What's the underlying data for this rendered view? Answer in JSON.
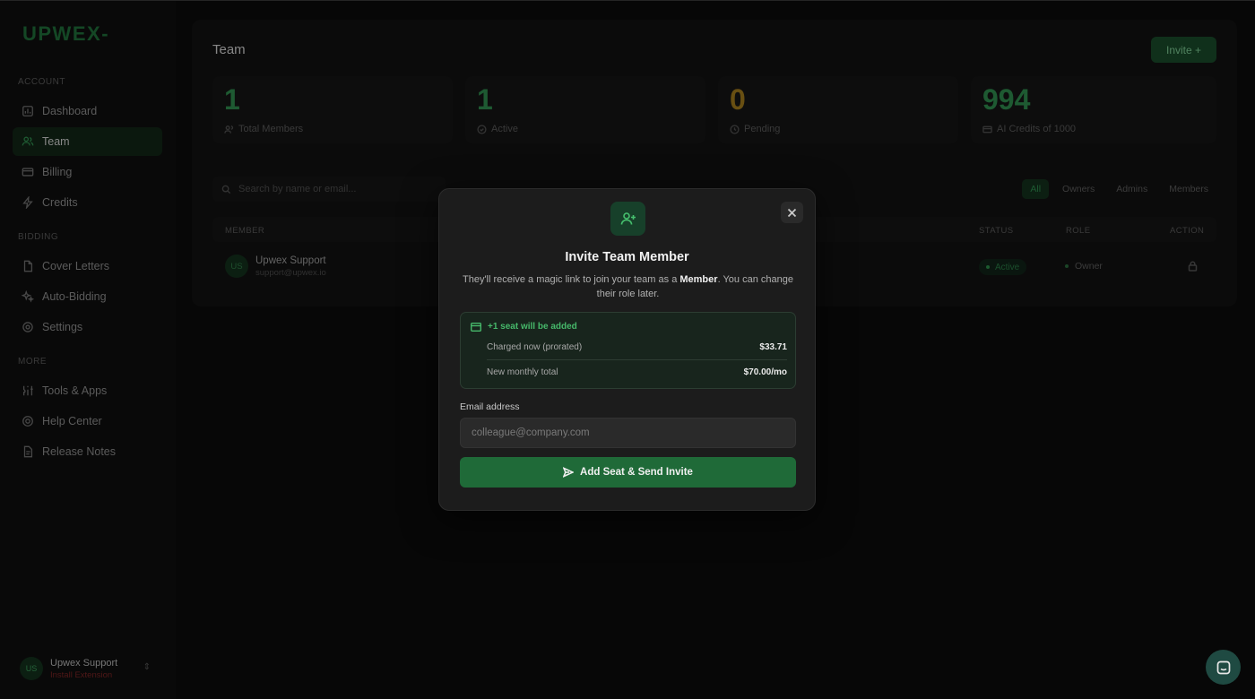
{
  "brand": {
    "logo": "UPWEX",
    "logo_suffix": "-"
  },
  "sidebar": {
    "sections": {
      "account": "ACCOUNT",
      "bidding": "BIDDING",
      "more": "MORE"
    },
    "items": [
      {
        "label": "Dashboard",
        "icon": "dashboard-icon"
      },
      {
        "label": "Team",
        "icon": "team-icon",
        "active": true
      },
      {
        "label": "Billing",
        "icon": "billing-icon"
      },
      {
        "label": "Credits",
        "icon": "bolt-icon"
      },
      {
        "label": "Cover Letters",
        "icon": "document-icon"
      },
      {
        "label": "Auto-Bidding",
        "icon": "sparkle-icon"
      },
      {
        "label": "Settings",
        "icon": "gear-icon"
      },
      {
        "label": "Tools & Apps",
        "icon": "tools-icon"
      },
      {
        "label": "Help Center",
        "icon": "help-icon"
      },
      {
        "label": "Release Notes",
        "icon": "notes-icon"
      }
    ],
    "user": {
      "initials": "US",
      "name": "Upwex Support",
      "sub": "Install Extension"
    }
  },
  "main": {
    "title": "Team",
    "invite_button": "Invite +",
    "stats": [
      {
        "value": "1",
        "label": "Total Members",
        "color": "#2f8b4d"
      },
      {
        "value": "1",
        "label": "Active",
        "color": "#2f8b4d"
      },
      {
        "value": "0",
        "label": "Pending",
        "color": "#a07a1c"
      },
      {
        "value": "994",
        "label": "AI Credits of 1000",
        "color": "#2f8b4d"
      }
    ],
    "search_placeholder": "Search by name or email...",
    "filters": [
      "All",
      "Owners",
      "Admins",
      "Members"
    ],
    "table": {
      "headers": {
        "member": "MEMBER",
        "status": "STATUS",
        "role": "ROLE",
        "action": "ACTION"
      },
      "rows": [
        {
          "initials": "US",
          "name": "Upwex Support",
          "email": "support@upwex.io",
          "status": "Active",
          "role": "Owner"
        }
      ]
    }
  },
  "modal": {
    "title": "Invite Team Member",
    "desc_before": "They'll receive a magic link to join your team as a ",
    "desc_role": "Member",
    "desc_after": ". You can change their role later.",
    "seat_notice": "+1 seat will be added",
    "charged_label": "Charged now (prorated)",
    "charged_value": "$33.71",
    "monthly_label": "New monthly total",
    "monthly_value": "$70.00/mo",
    "email_label": "Email address",
    "email_placeholder": "colleague@company.com",
    "email_value": "",
    "submit_label": "Add Seat & Send Invite"
  },
  "colors": {
    "accent": "#1f6a38",
    "accent_text": "#46c06e",
    "pending": "#a07a1c"
  }
}
